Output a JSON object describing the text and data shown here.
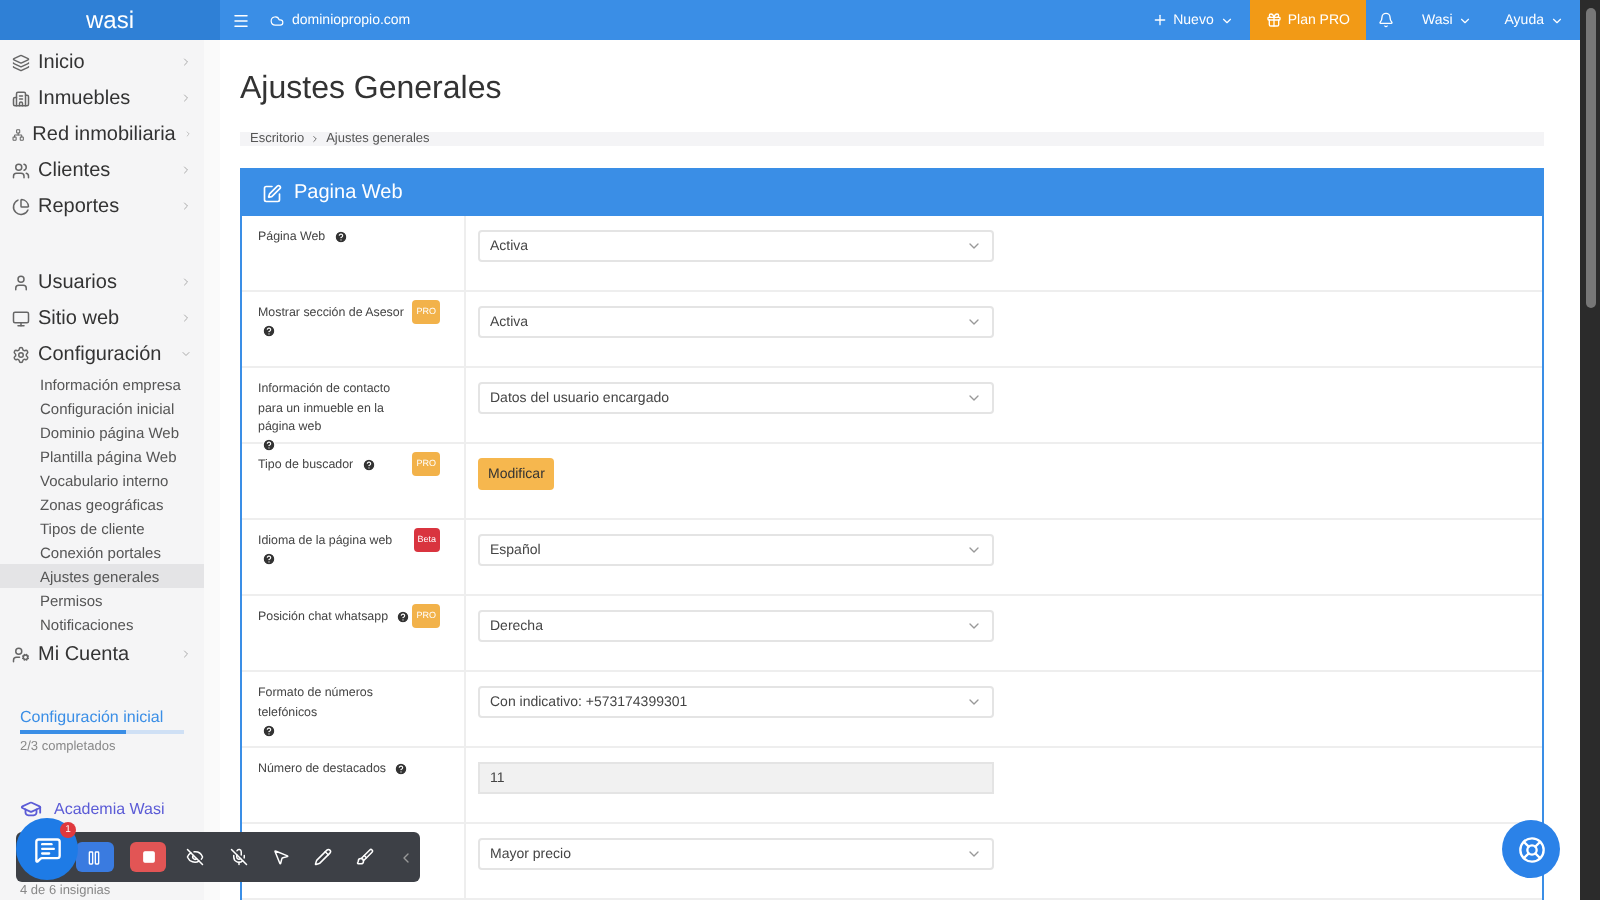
{
  "topbar": {
    "logo": "wasi",
    "domain": "dominiopropio.com",
    "new_button": "Nuevo",
    "plan_button": "Plan PRO",
    "user_menu": "Wasi",
    "help_menu": "Ayuda"
  },
  "sidebar": {
    "groups": [
      [
        {
          "label": "Inicio"
        },
        {
          "label": "Inmuebles"
        },
        {
          "label": "Red inmobiliaria"
        },
        {
          "label": "Clientes"
        },
        {
          "label": "Reportes"
        }
      ],
      [
        {
          "label": "Usuarios",
          "expanded": false
        },
        {
          "label": "Sitio web",
          "expanded": false
        },
        {
          "label": "Configuración",
          "expanded": true,
          "children": [
            {
              "label": "Información empresa",
              "selected": false
            },
            {
              "label": "Configuración inicial",
              "selected": false
            },
            {
              "label": "Dominio página Web",
              "selected": false
            },
            {
              "label": "Plantilla página Web",
              "selected": false
            },
            {
              "label": "Vocabulario interno",
              "selected": false
            },
            {
              "label": "Zonas geográficas",
              "selected": false
            },
            {
              "label": "Tipos de cliente",
              "selected": false
            },
            {
              "label": "Conexión portales",
              "selected": false
            },
            {
              "label": "Ajustes generales",
              "selected": true
            },
            {
              "label": "Permisos",
              "selected": false
            },
            {
              "label": "Notificaciones",
              "selected": false
            }
          ]
        },
        {
          "label": "Mi Cuenta",
          "expanded": false
        }
      ]
    ],
    "setup": {
      "title": "Configuración inicial",
      "level": 0.65,
      "progress": "2/3 completados"
    },
    "academy": {
      "title": "Academia Wasi",
      "badges": "4 de 6 insignias"
    }
  },
  "page": {
    "title": "Ajustes Generales",
    "breadcrumb": [
      "Escritorio",
      "Ajustes generales"
    ]
  },
  "panel": {
    "title": "Pagina Web",
    "rows": [
      {
        "label": "Página Web",
        "control": {
          "kind": "select",
          "value": "Activa"
        }
      },
      {
        "label": "Mostrar sección de Asesor",
        "badge": {
          "kind": "pro",
          "text": "PRO"
        },
        "control": {
          "kind": "select",
          "value": "Activa"
        }
      },
      {
        "label": "Información de contacto para un inmueble en la página web",
        "control": {
          "kind": "select",
          "value": "Datos del usuario encargado"
        }
      },
      {
        "label": "Tipo de buscador",
        "badge": {
          "kind": "pro",
          "text": "PRO"
        },
        "control": {
          "kind": "button",
          "value": "Modificar"
        }
      },
      {
        "label": "Idioma de la página web",
        "badge": {
          "kind": "beta",
          "text": "Beta"
        },
        "control": {
          "kind": "select",
          "value": "Español"
        }
      },
      {
        "label": "Posición chat whatsapp",
        "badge": {
          "kind": "pro",
          "text": "PRO"
        },
        "control": {
          "kind": "select",
          "value": "Derecha"
        }
      },
      {
        "label": "Formato de números telefónicos",
        "control": {
          "kind": "select",
          "value": "Con indicativo: +573174399301"
        }
      },
      {
        "label": "Número de destacados",
        "control": {
          "kind": "input",
          "value": "11"
        }
      },
      {
        "control": {
          "kind": "select",
          "value": "Mayor precio"
        }
      }
    ]
  },
  "chat_widget": {
    "badge": "1"
  }
}
